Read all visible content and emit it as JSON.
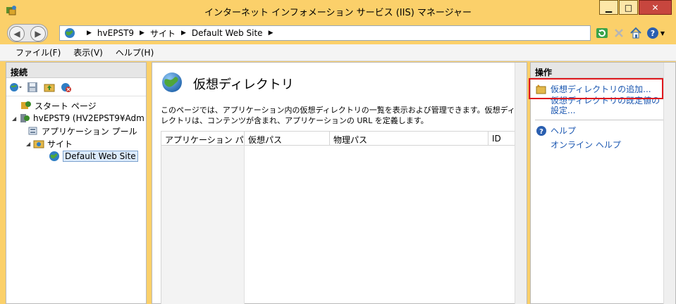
{
  "window": {
    "title": "インターネット インフォメーション サービス (IIS) マネージャー",
    "minimize": "▁",
    "maximize": "□",
    "close": "✕"
  },
  "address": {
    "crumbs": [
      "hvEPST9",
      "サイト",
      "Default Web Site"
    ]
  },
  "menu": [
    "ファイル(F)",
    "表示(V)",
    "ヘルプ(H)"
  ],
  "connections": {
    "header": "接続",
    "tree": [
      {
        "label": "スタート ページ",
        "level": 1,
        "expander": "",
        "icon": "start-page-icon"
      },
      {
        "label": "hvEPST9 (HV2EPST9¥Adm",
        "level": 0,
        "expander": "◢",
        "icon": "server-icon"
      },
      {
        "label": "アプリケーション プール",
        "level": 2,
        "expander": "",
        "icon": "app-pool-icon"
      },
      {
        "label": "サイト",
        "level": 1,
        "expander": "◢",
        "icon": "sites-folder-icon"
      },
      {
        "label": "Default Web Site",
        "level": 2,
        "expander": "",
        "icon": "globe-icon"
      }
    ]
  },
  "main": {
    "title": "仮想ディレクトリ",
    "description": "このページでは、アプリケーション内の仮想ディレクトリの一覧を表示および管理できます。仮想ディレクトリは、コンテンツが含まれ、アプリケーションの URL を定義します。",
    "columns": [
      "アプリケーション パス",
      "仮想パス",
      "物理パス",
      "ID"
    ]
  },
  "actions": {
    "header": "操作",
    "add_vdir": "仮想ディレクトリの追加...",
    "vdir_defaults": "仮想ディレクトリの既定値の設定...",
    "help": "ヘルプ",
    "online_help": "オンライン ヘルプ"
  },
  "colors": {
    "title_bg": "#fbd06a",
    "link": "#1a56b0",
    "highlight": "#e0191e",
    "close_btn": "#c7463e"
  }
}
